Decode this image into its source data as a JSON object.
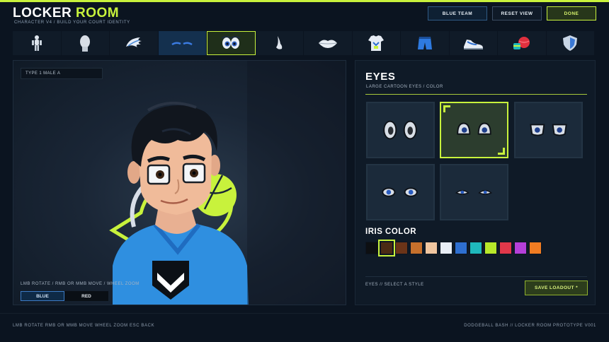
{
  "header": {
    "title_main": "LOCKER",
    "title_accent": "ROOM",
    "subtitle": "CHARACTER V4  /  BUILD YOUR COURT IDENTITY",
    "team_button": "BLUE TEAM",
    "reset_button": "RESET VIEW",
    "done_button": "DONE"
  },
  "categories": [
    {
      "icon": "full-body-icon",
      "active": false
    },
    {
      "icon": "head-shape-icon",
      "active": false
    },
    {
      "icon": "hair-icon",
      "active": false
    },
    {
      "icon": "eyebrows-icon",
      "active": false
    },
    {
      "icon": "eyes-icon",
      "active": true
    },
    {
      "icon": "nose-icon",
      "active": false
    },
    {
      "icon": "lips-icon",
      "active": false
    },
    {
      "icon": "jersey-icon",
      "active": false
    },
    {
      "icon": "shorts-icon",
      "active": false
    },
    {
      "icon": "shoes-icon",
      "active": false
    },
    {
      "icon": "dodgeball-icon",
      "active": false
    },
    {
      "icon": "shield-icon",
      "active": false
    }
  ],
  "viewport": {
    "preset": "TYPE 1 MALE A",
    "controls_hint": "LMB ROTATE  /  RMB OR MMB MOVE  /  WHEEL ZOOM",
    "team_blue": "BLUE",
    "team_red": "RED"
  },
  "panel": {
    "title": "EYES",
    "subtitle": "LARGE CARTOON EYES  /  COLOR",
    "eye_options": [
      {
        "style": "large-oval",
        "selected": false
      },
      {
        "style": "round-blue",
        "selected": true
      },
      {
        "style": "half-lid",
        "selected": false
      },
      {
        "style": "almond",
        "selected": false
      },
      {
        "style": "narrow",
        "selected": false
      }
    ],
    "iris_title": "IRIS COLOR",
    "iris_colors": [
      "#0d0f12",
      "#4a2a14",
      "#6b3418",
      "#c6702c",
      "#f0c6a0",
      "#e8eef6",
      "#2e6fd0",
      "#1fb8bc",
      "#b8e82a",
      "#e0384a",
      "#b53fd8",
      "#f07c22"
    ],
    "iris_selected": 1,
    "hint": "EYES  //  SELECT A STYLE",
    "save_button": "SAVE LOADOUT *"
  },
  "footer": {
    "left": "LMB  ROTATE     RMB OR MMB  MOVE     WHEEL  ZOOM     ESC  BACK",
    "right": "DODGEBALL BASH  //  LOCKER ROOM PROTOTYPE V001"
  }
}
